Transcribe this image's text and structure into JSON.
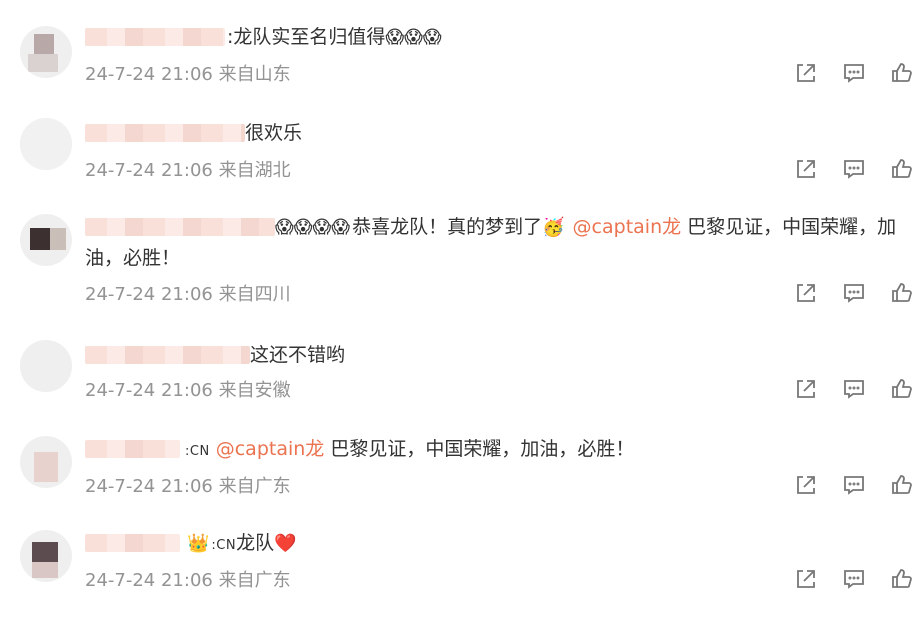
{
  "comments": [
    {
      "text_suffix": ":龙队实至名归值得",
      "emojis": "😱😱😱",
      "time": "24-7-24 21:06",
      "location": "来自山东"
    },
    {
      "text_suffix": "很欢乐",
      "time": "24-7-24 21:06",
      "location": "来自湖北"
    },
    {
      "emojis": "😱😱😱😱",
      "text_a": "恭喜龙队！真的梦到了",
      "emoji2": "🥳",
      "mention": "@captain龙",
      "text_b": " 巴黎见证，中国荣耀，加油，必胜！",
      "time": "24-7-24 21:06",
      "location": "来自四川"
    },
    {
      "text_suffix": "这还不错哟",
      "time": "24-7-24 21:06",
      "location": "来自安徽"
    },
    {
      "badge": ":CN",
      "mention": "@captain龙",
      "text_b": " 巴黎见证，中国荣耀，加油，必胜！",
      "time": "24-7-24 21:06",
      "location": "来自广东"
    },
    {
      "crown": "👑",
      "badge": ":CN",
      "text_suffix": "龙队",
      "heart": "❤️",
      "time": "24-7-24 21:06",
      "location": "来自广东"
    }
  ],
  "icons": [
    "share-icon",
    "comment-icon",
    "like-icon"
  ],
  "colors": {
    "mention": "#eb7350",
    "meta": "#939393",
    "text": "#333333"
  }
}
